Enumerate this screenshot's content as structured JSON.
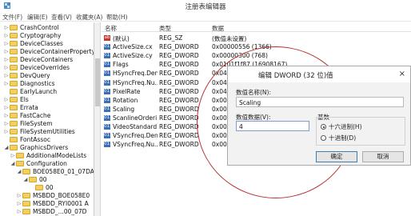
{
  "window": {
    "title": "注册表编辑器"
  },
  "menu": [
    "文件(F)",
    "编辑(E)",
    "查看(V)",
    "收藏夹(A)",
    "帮助(H)"
  ],
  "tree": [
    {
      "label": "CrashControl",
      "depth": 1,
      "arrow": "▷"
    },
    {
      "label": "Cryptography",
      "depth": 1,
      "arrow": "▷"
    },
    {
      "label": "DeviceClasses",
      "depth": 1,
      "arrow": "▷"
    },
    {
      "label": "DeviceContainerPropertyU",
      "depth": 1,
      "arrow": "▷"
    },
    {
      "label": "DeviceContainers",
      "depth": 1,
      "arrow": "▷"
    },
    {
      "label": "DeviceOverrides",
      "depth": 1,
      "arrow": "▷"
    },
    {
      "label": "DevQuery",
      "depth": 1,
      "arrow": "▷"
    },
    {
      "label": "Diagnostics",
      "depth": 1,
      "arrow": "▷"
    },
    {
      "label": "EarlyLaunch",
      "depth": 1,
      "arrow": ""
    },
    {
      "label": "Els",
      "depth": 1,
      "arrow": "▷"
    },
    {
      "label": "Errata",
      "depth": 1,
      "arrow": "▷"
    },
    {
      "label": "FastCache",
      "depth": 1,
      "arrow": "▷"
    },
    {
      "label": "FileSystem",
      "depth": 1,
      "arrow": "▷"
    },
    {
      "label": "FileSystemUtilities",
      "depth": 1,
      "arrow": "▷"
    },
    {
      "label": "FontAssoc",
      "depth": 1,
      "arrow": ""
    },
    {
      "label": "GraphicsDrivers",
      "depth": 1,
      "arrow": "◢"
    },
    {
      "label": "AdditionalModeLists",
      "depth": 2,
      "arrow": "▷"
    },
    {
      "label": "Configuration",
      "depth": 2,
      "arrow": "◢"
    },
    {
      "label": "BOE058E0_01_07DA",
      "depth": 3,
      "arrow": "◢"
    },
    {
      "label": "00",
      "depth": 4,
      "arrow": "◢"
    },
    {
      "label": "00",
      "depth": 5,
      "arrow": ""
    },
    {
      "label": "MSBDD_BOE058E0",
      "depth": 3,
      "arrow": "▷"
    },
    {
      "label": "MSBDD_RYI0001 A",
      "depth": 3,
      "arrow": "▷"
    },
    {
      "label": "MSBDD_...00_07D",
      "depth": 3,
      "arrow": "▷"
    }
  ],
  "list": {
    "headers": {
      "name": "名称",
      "type": "类型",
      "data": "数据"
    },
    "rows": [
      {
        "kind": "sz",
        "icon": "ab",
        "name": "(默认)",
        "type": "REG_SZ",
        "data": "(数值未设置)"
      },
      {
        "kind": "dw",
        "icon": "011",
        "name": "ActiveSize.cx",
        "type": "REG_DWORD",
        "data": "0x00000556 (1366)"
      },
      {
        "kind": "dw",
        "icon": "011",
        "name": "ActiveSize.cy",
        "type": "REG_DWORD",
        "data": "0x00000300 (768)"
      },
      {
        "kind": "dw",
        "icon": "011",
        "name": "Flags",
        "type": "REG_DWORD",
        "data": "0x0101f1f87 (16908167)"
      },
      {
        "kind": "dw",
        "icon": "011",
        "name": "HSyncFreq.Den...",
        "type": "REG_DWORD",
        "data": "0x04"
      },
      {
        "kind": "dw",
        "icon": "011",
        "name": "HSyncFreq.Nu...",
        "type": "REG_DWORD",
        "data": "0x04"
      },
      {
        "kind": "dw",
        "icon": "011",
        "name": "PixelRate",
        "type": "REG_DWORD",
        "data": "0x04"
      },
      {
        "kind": "dw",
        "icon": "011",
        "name": "Rotation",
        "type": "REG_DWORD",
        "data": "0x00"
      },
      {
        "kind": "dw",
        "icon": "011",
        "name": "Scaling",
        "type": "REG_DWORD",
        "data": "0x00"
      },
      {
        "kind": "dw",
        "icon": "011",
        "name": "ScanlineOrderi...",
        "type": "REG_DWORD",
        "data": "0x00"
      },
      {
        "kind": "dw",
        "icon": "011",
        "name": "VideoStandard",
        "type": "REG_DWORD",
        "data": "0x00"
      },
      {
        "kind": "dw",
        "icon": "011",
        "name": "VSyncFreq.Den...",
        "type": "REG_DWORD",
        "data": "0x00"
      },
      {
        "kind": "dw",
        "icon": "011",
        "name": "VSyncFreq.Nu...",
        "type": "REG_DWORD",
        "data": "0x00"
      }
    ]
  },
  "dialog": {
    "title": "编辑 DWORD (32 位)值",
    "close": "×",
    "name_label": "数值名称(N):",
    "name_value": "Scaling",
    "data_label": "数值数据(V):",
    "data_value": "4",
    "base_label": "基数",
    "hex_label": "十六进制(H)",
    "dec_label": "十进制(D)",
    "ok": "确定",
    "cancel": "取消"
  },
  "colors": {
    "annotation_circle": "#b53232",
    "folder": "#f3cf63",
    "dword_icon": "#3b6fb6",
    "sz_icon": "#c0392b"
  }
}
